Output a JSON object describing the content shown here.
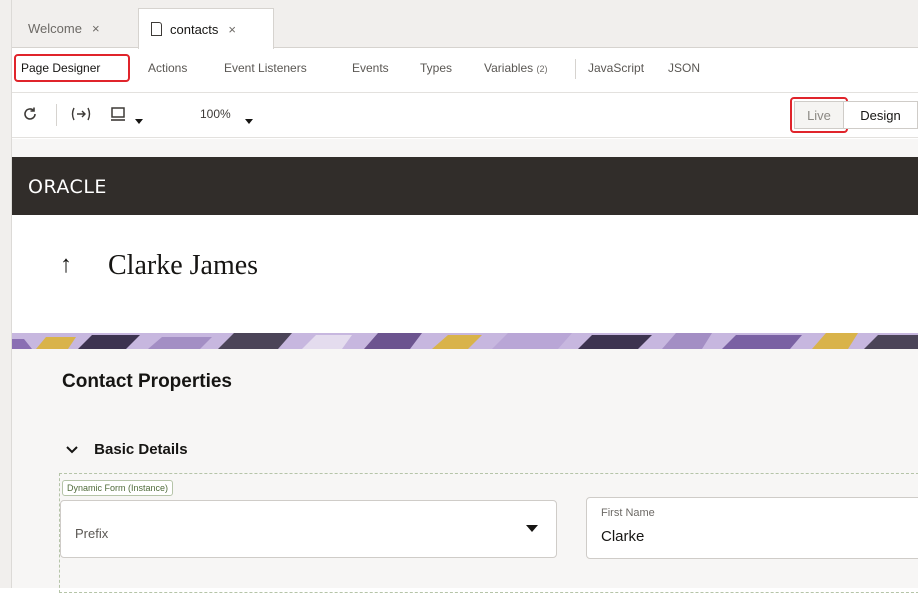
{
  "file_tabs": [
    {
      "label": "Welcome",
      "close": "×"
    },
    {
      "label": "contacts",
      "close": "×"
    }
  ],
  "designer_tabs": {
    "page_designer": "Page Designer",
    "actions": "Actions",
    "event_listeners": "Event Listeners",
    "events": "Events",
    "types": "Types",
    "variables": "Variables",
    "variables_count": "(2)",
    "javascript": "JavaScript",
    "json": "JSON"
  },
  "toolbar": {
    "zoom": "100%",
    "live_label": "Live",
    "design_label": "Design"
  },
  "preview": {
    "logo_text": "ORACLE",
    "back_arrow": "↑",
    "page_title": "Clarke James",
    "section_title": "Contact Properties",
    "group_chevron": "⌄",
    "group_title": "Basic Details",
    "dynamic_form_label": "Dynamic Form (Instance)",
    "prefix_placeholder": "Prefix",
    "first_name_label": "First Name",
    "first_name_value": "Clarke"
  },
  "colors": {
    "highlight": "#e0242b",
    "appbar": "#312d2a",
    "banner_purple": "#a38ec4",
    "banner_gold": "#d9b34a"
  },
  "icons": [
    "document-icon",
    "refresh-icon",
    "toggle-code-icon",
    "device-icon",
    "chevron-down-icon"
  ]
}
